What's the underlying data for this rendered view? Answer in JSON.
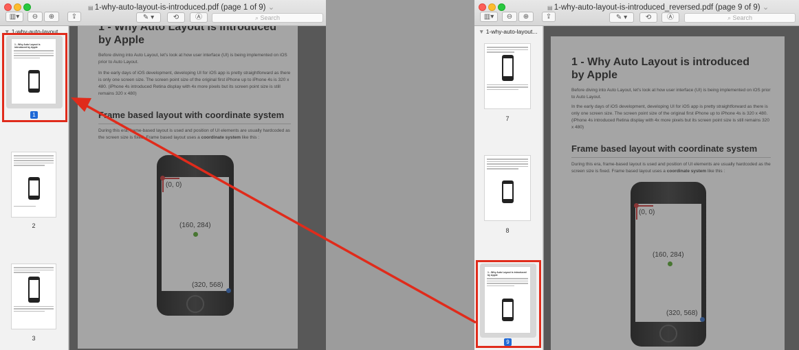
{
  "left_window": {
    "title": "1-why-auto-layout-is-introduced.pdf (page 1 of 9)",
    "sidebar_header": "1-why-auto-layout...",
    "search_placeholder": "Search",
    "thumbnails": [
      {
        "label": "1",
        "selected": true
      },
      {
        "label": "2"
      },
      {
        "label": "3"
      }
    ],
    "page": {
      "heading": "1 - Why Auto Layout is introduced by Apple",
      "para1": "Before diving into Auto Layout, let's look at how user interface (UI) is being implemented on iOS prior to Auto Layout.",
      "para2": "In the early days of iOS development, developing UI for iOS app is pretty straightforward as there is only one screen size. The screen point size of the original first iPhone up to iPhone 4s is 320 x 480. (iPhone 4s introduced Retina display with 4x more pixels but its screen point size is still remains 320 x 480)",
      "subheading": "Frame based layout with coordinate system",
      "para3_prefix": "During this era, frame-based layout is used and position of UI elements are usually hardcoded as the screen size is fixed. Frame based layout uses a ",
      "para3_bold": "coordinate system",
      "para3_suffix": " like this :",
      "coord_origin": "(0, 0)",
      "coord_center": "(160, 284)",
      "coord_end": "(320, 568)"
    }
  },
  "right_window": {
    "title": "1-why-auto-layout-is-introduced_reversed.pdf (page 9 of 9)",
    "sidebar_header": "1-why-auto-layout...",
    "search_placeholder": "Search",
    "thumbnails": [
      {
        "label": "7"
      },
      {
        "label": "8"
      },
      {
        "label": "9",
        "selected": true
      }
    ],
    "page": {
      "heading": "1 - Why Auto Layout is introduced by Apple",
      "para1": "Before diving into Auto Layout, let's look at how user interface (UI) is being implemented on iOS prior to Auto Layout.",
      "para2": "In the early days of iOS development, developing UI for iOS app is pretty straightforward as there is only one screen size. The screen point size of the original first iPhone up to iPhone 4s is 320 x 480. (iPhone 4s introduced Retina display with 4x more pixels but its screen point size is still remains 320 x 480)",
      "subheading": "Frame based layout with coordinate system",
      "para3_prefix": "During this era, frame-based layout is used and position of UI elements are usually hardcoded as the screen size is fixed. Frame based layout uses a ",
      "para3_bold": "coordinate system",
      "para3_suffix": " like this :",
      "coord_origin": "(0, 0)",
      "coord_center": "(160, 284)",
      "coord_end": "(320, 568)"
    }
  },
  "colors": {
    "annotation": "#e02b1b",
    "selection": "#1f69d6",
    "center_dot": "#5fae3a",
    "end_dot": "#3b73c8",
    "origin_marker": "#d04040"
  },
  "icons": [
    "sidebar-toggle-icon",
    "zoom-out-icon",
    "zoom-in-icon",
    "share-icon",
    "markup-pen-icon",
    "rotate-icon",
    "annotate-icon"
  ]
}
